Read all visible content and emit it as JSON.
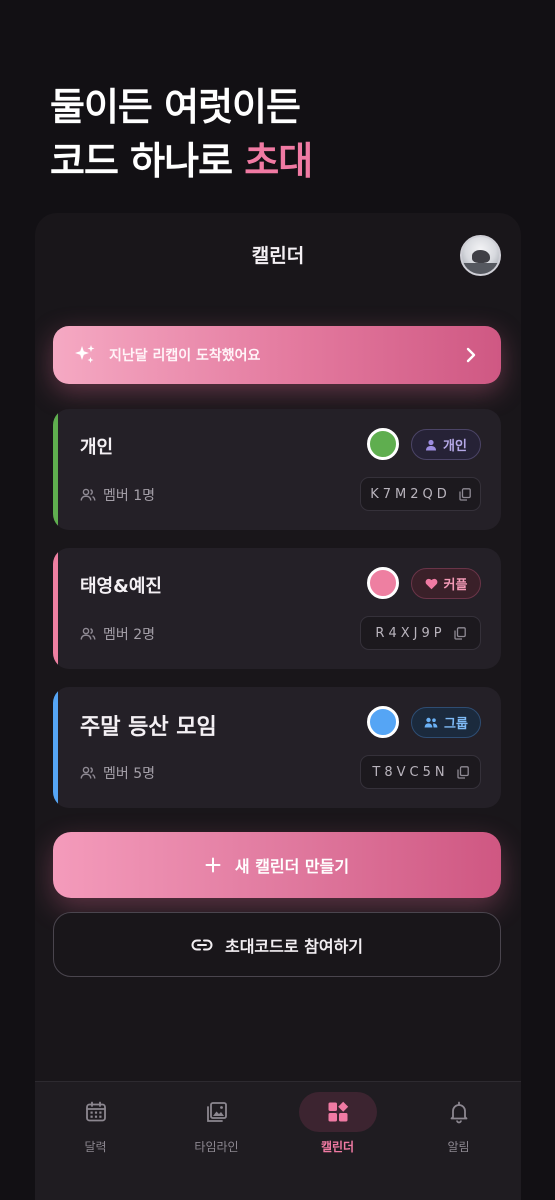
{
  "headline": {
    "line1": "둘이든 여럿이든",
    "line2_prefix": "코드 하나로 ",
    "line2_accent": "초대"
  },
  "header": {
    "title": "캘린더"
  },
  "banner": {
    "text": "지난달 리캡이 도착했어요"
  },
  "calendars": [
    {
      "name": "개인",
      "color": "#5fae4f",
      "stripe": "#5fae4f",
      "type_label": "개인",
      "type_icon": "person-icon",
      "members": "멤버 1명",
      "code": "K7M2QD"
    },
    {
      "name": "태영&예진",
      "color": "#ee7fa1",
      "stripe": "#ee7fa1",
      "type_label": "커플",
      "type_icon": "heart-icon",
      "members": "멤버 2명",
      "code": "R4XJ9P"
    },
    {
      "name": "주말 등산 모임",
      "color": "#55a5f5",
      "stripe": "#55a5f5",
      "type_label": "그룹",
      "type_icon": "group-icon",
      "members": "멤버 5명",
      "code": "T8VC5N"
    }
  ],
  "actions": {
    "create_label": "새 캘린더 만들기",
    "join_label": "초대코드로 참여하기"
  },
  "tabs": [
    {
      "label": "달력",
      "icon": "calendar-icon"
    },
    {
      "label": "타임라인",
      "icon": "gallery-icon"
    },
    {
      "label": "캘린더",
      "icon": "grid-icon",
      "active": true
    },
    {
      "label": "알림",
      "icon": "bell-icon"
    }
  ],
  "colors": {
    "accent": "#f07aa3",
    "background": "#121014",
    "card": "#242027"
  }
}
